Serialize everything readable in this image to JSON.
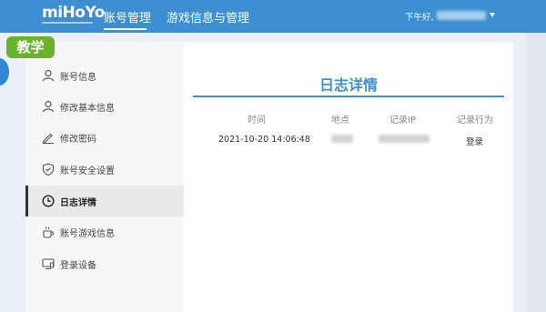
{
  "header": {
    "logo": "miHoYo",
    "nav": [
      "账号管理",
      "游戏信息与管理"
    ],
    "greeting": "下午好,"
  },
  "badge": "教学",
  "sidebar": {
    "items": [
      {
        "label": "账号信息",
        "icon": "user-icon"
      },
      {
        "label": "修改基本信息",
        "icon": "user-edit-icon"
      },
      {
        "label": "修改密码",
        "icon": "pencil-icon"
      },
      {
        "label": "账号安全设置",
        "icon": "shield-check-icon"
      },
      {
        "label": "日志详情",
        "icon": "clock-icon",
        "active": true
      },
      {
        "label": "账号游戏信息",
        "icon": "coffee-cup-icon"
      },
      {
        "label": "登录设备",
        "icon": "device-icon"
      }
    ]
  },
  "main": {
    "title": "日志详情",
    "columns": [
      "时间",
      "地点",
      "记录IP",
      "记录行为"
    ],
    "rows": [
      {
        "time": "2021-10-20 14:06:48",
        "action": "登录"
      }
    ]
  },
  "colors": {
    "accent": "#3d8fd1",
    "badge": "#6ab22a",
    "sidebar_bg": "#f7f7f7"
  }
}
